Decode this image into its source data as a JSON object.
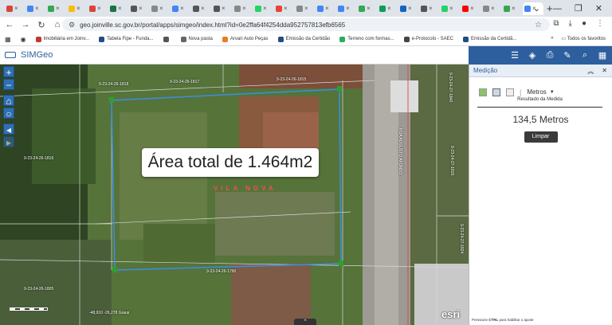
{
  "browser": {
    "tab_colors": [
      "#db4437",
      "#4285f4",
      "#34a853",
      "#fbbc05",
      "#db4437",
      "#1a7343",
      "#555555",
      "#888888",
      "#4285f4",
      "#555555",
      "#555555",
      "#888888",
      "#25d366",
      "#ea4335",
      "#888888",
      "#4285f4",
      "#4285f4",
      "#34a853",
      "#0f9d58",
      "#1565c0",
      "#555555",
      "#25d366",
      "#ff0000",
      "#888888",
      "#34a853",
      "#4285f4"
    ],
    "url": "geo.joinville.sc.gov.br/portal/apps/simgeo/index.html?id=0e2ffa64f4254dda952757813efb6565",
    "bookmarks": [
      {
        "label": "Imobiliária em Joinv...",
        "color": "#c0392b"
      },
      {
        "label": "Tabela Fipe - Funda...",
        "color": "#1f4f85"
      },
      {
        "label": "",
        "color": "#555555"
      },
      {
        "label": "Nova pasta",
        "color": "#666666"
      },
      {
        "label": "Arvari Auto Peças",
        "color": "#e67e22"
      },
      {
        "label": "Emissão da Certidão",
        "color": "#1f4f85"
      },
      {
        "label": "Terreno com formas...",
        "color": "#27ae60"
      },
      {
        "label": "e-Protocolo - SAEC",
        "color": "#444444"
      },
      {
        "label": "Emissão da Certidã...",
        "color": "#1f4f85"
      }
    ],
    "all_favorites": "Todos os favoritos"
  },
  "app": {
    "title": "SIMGeo"
  },
  "map": {
    "area_label": "Área total de 1.464m2",
    "district": "VILA NOVA",
    "lots": [
      "9-23-24-26-1818",
      "9-23-24-26-1817",
      "9-23-24-26-1815",
      "9-23-24-26-1816",
      "9-23-24-26-1790",
      "9-23-24-26-1805",
      "9-23-24-27-1840",
      "9-23-24-27-1815",
      "9-23-24-27-1824"
    ],
    "street": "RUA AUGUSTO AFONSO",
    "coords": "-48,910 -26,278 Graus",
    "esri": "esri"
  },
  "panel": {
    "title": "Medição",
    "unit": "Metros",
    "result_title": "Resultado da Medida",
    "result_value": "134,5 Metros",
    "clear_label": "Limpar",
    "ctrl_note_pre": "Pressione ",
    "ctrl_note_key": "CTRL",
    "ctrl_note_post": " para habilitar o ajuste"
  }
}
